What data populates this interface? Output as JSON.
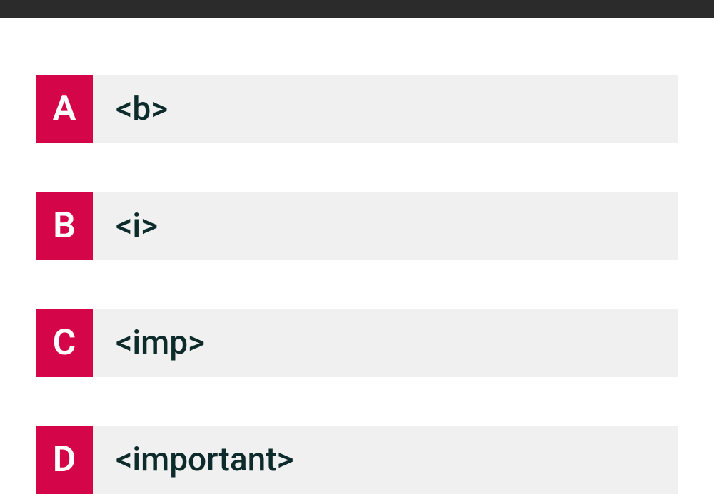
{
  "options": [
    {
      "letter": "A",
      "text": "<b>"
    },
    {
      "letter": "B",
      "text": "<i>"
    },
    {
      "letter": "C",
      "text": "<imp>"
    },
    {
      "letter": "D",
      "text": "<important>"
    }
  ],
  "colors": {
    "accent": "#d5054a",
    "topbar": "#2b2b2b",
    "optionBg": "#f0f0f0",
    "optionText": "#0d2b2b"
  }
}
